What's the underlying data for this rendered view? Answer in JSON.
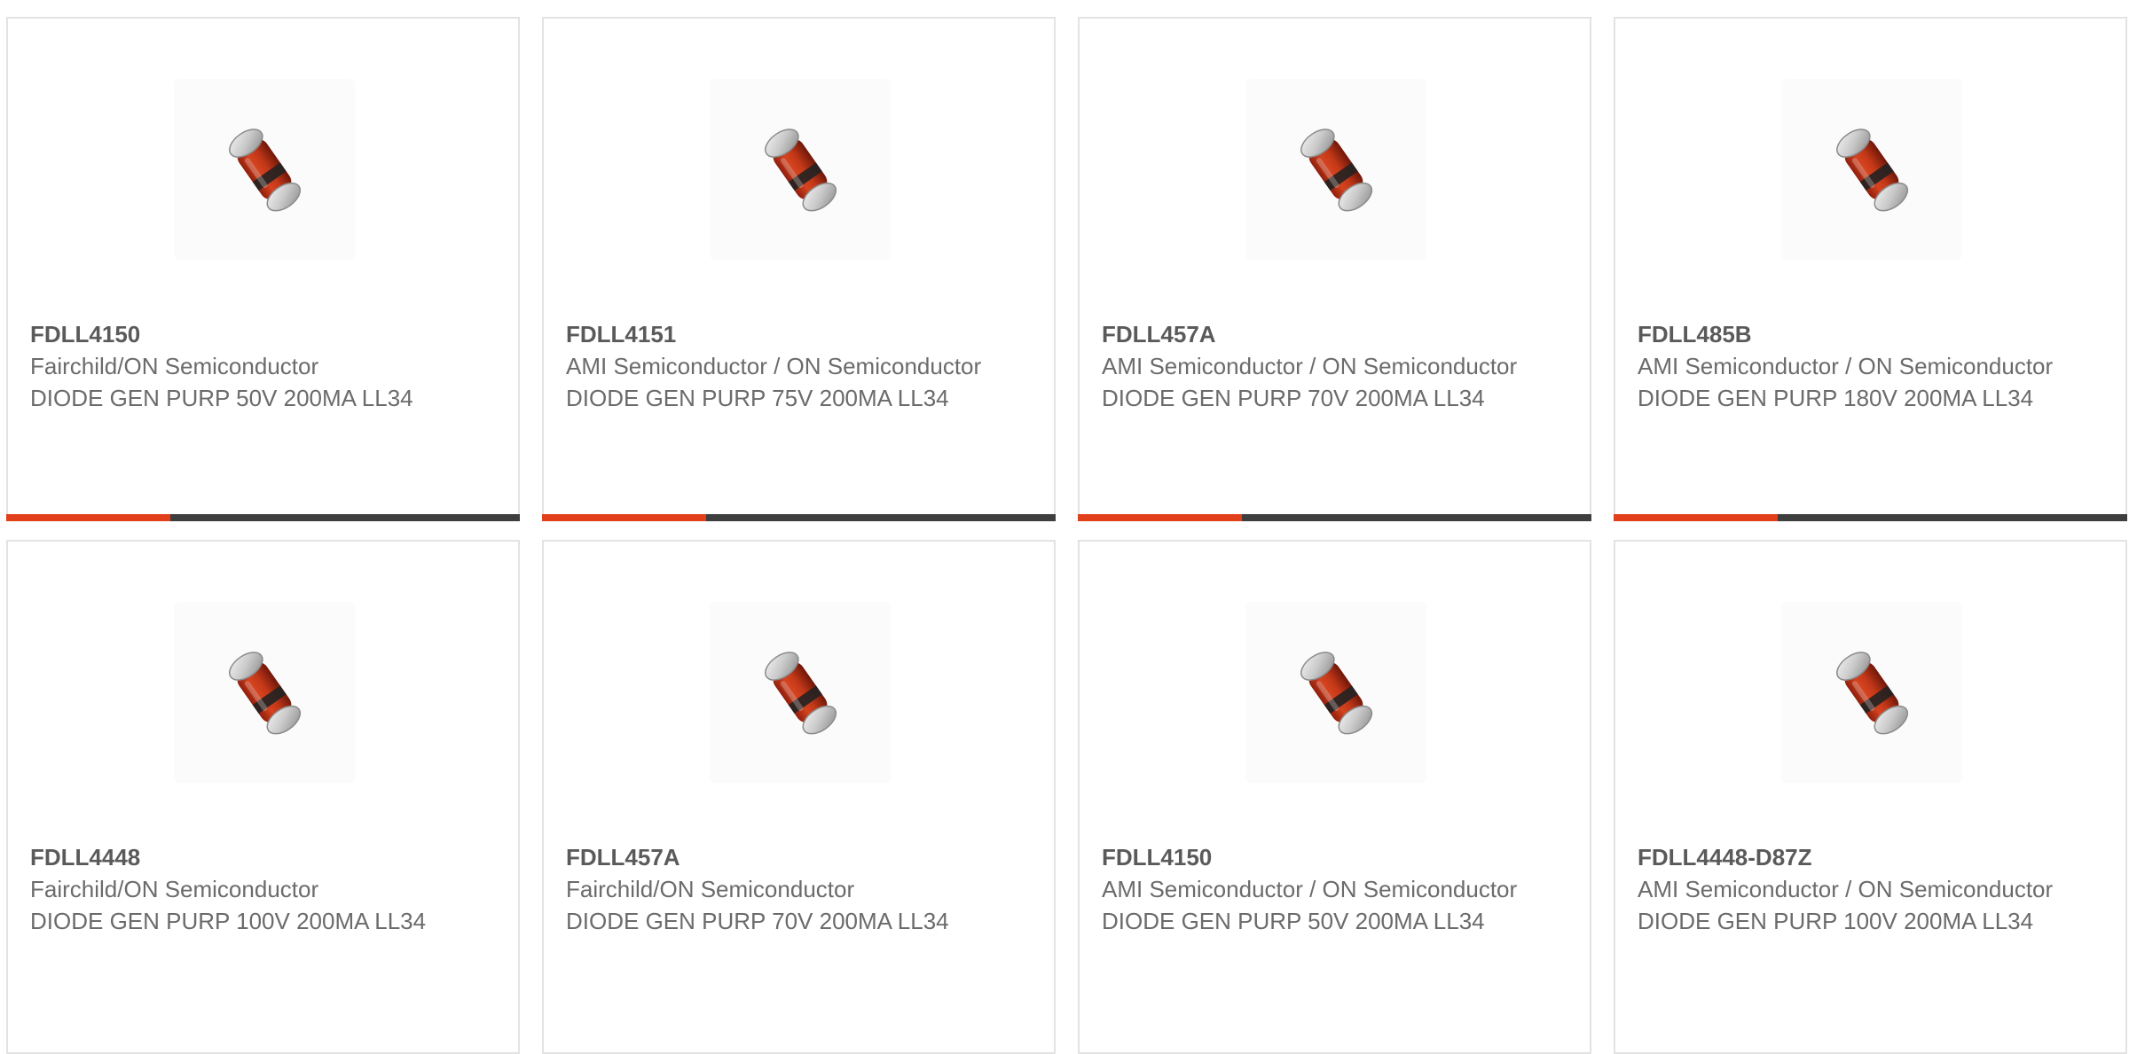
{
  "colors": {
    "accent": "#e2401b",
    "bar_track": "#3e3e3e",
    "card_border": "#e3e3e3",
    "text": "#6b6b6b"
  },
  "products": [
    {
      "part_number": "FDLL4150",
      "manufacturer": "Fairchild/ON Semiconductor",
      "description": "DIODE GEN PURP 50V 200MA LL34",
      "image_icon": "diode-ll34-icon",
      "progress": 0.32
    },
    {
      "part_number": "FDLL4151",
      "manufacturer": "AMI Semiconductor / ON Semiconductor",
      "description": "DIODE GEN PURP 75V 200MA LL34",
      "image_icon": "diode-ll34-icon",
      "progress": 0.32
    },
    {
      "part_number": "FDLL457A",
      "manufacturer": "AMI Semiconductor / ON Semiconductor",
      "description": "DIODE GEN PURP 70V 200MA LL34",
      "image_icon": "diode-ll34-icon",
      "progress": 0.32
    },
    {
      "part_number": "FDLL485B",
      "manufacturer": "AMI Semiconductor / ON Semiconductor",
      "description": "DIODE GEN PURP 180V 200MA LL34",
      "image_icon": "diode-ll34-icon",
      "progress": 0.32
    },
    {
      "part_number": "FDLL4448",
      "manufacturer": "Fairchild/ON Semiconductor",
      "description": "DIODE GEN PURP 100V 200MA LL34",
      "image_icon": "diode-ll34-icon"
    },
    {
      "part_number": "FDLL457A",
      "manufacturer": "Fairchild/ON Semiconductor",
      "description": "DIODE GEN PURP 70V 200MA LL34",
      "image_icon": "diode-ll34-icon"
    },
    {
      "part_number": "FDLL4150",
      "manufacturer": "AMI Semiconductor / ON Semiconductor",
      "description": "DIODE GEN PURP 50V 200MA LL34",
      "image_icon": "diode-ll34-icon"
    },
    {
      "part_number": "FDLL4448-D87Z",
      "manufacturer": "AMI Semiconductor / ON Semiconductor",
      "description": "DIODE GEN PURP 100V 200MA LL34",
      "image_icon": "diode-ll34-icon"
    }
  ]
}
